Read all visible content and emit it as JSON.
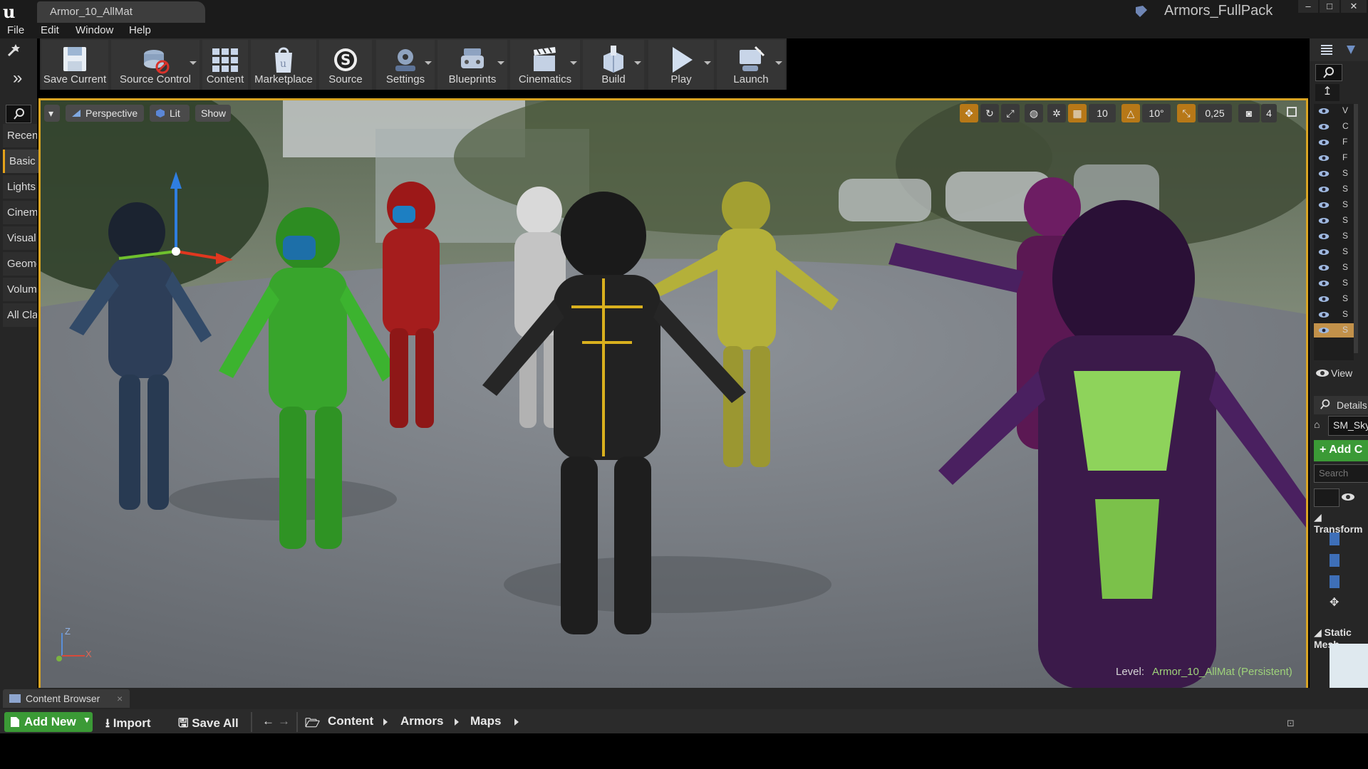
{
  "window": {
    "doc_tab": "Armor_10_AllMat",
    "project_name": "Armors_FullPack",
    "controls": [
      "–",
      "□",
      "✕"
    ]
  },
  "menu": [
    "File",
    "Edit",
    "Window",
    "Help"
  ],
  "modes_panel": {
    "tabs": [
      "Recently Placed",
      "Basic",
      "Lights",
      "Cinematic",
      "Visual Effects",
      "Geometry",
      "Volumes",
      "All Classes"
    ],
    "selected": "Basic"
  },
  "toolbar": [
    {
      "label": "Save Current",
      "icon": "save-icon",
      "dropdown": false
    },
    {
      "label": "Source Control",
      "icon": "source-control-icon",
      "dropdown": true
    },
    {
      "label": "Content",
      "icon": "content-icon",
      "dropdown": false
    },
    {
      "label": "Marketplace",
      "icon": "marketplace-icon",
      "dropdown": false
    },
    {
      "label": "Source",
      "icon": "source-icon",
      "dropdown": false
    },
    {
      "label": "Settings",
      "icon": "settings-icon",
      "dropdown": true
    },
    {
      "label": "Blueprints",
      "icon": "blueprints-icon",
      "dropdown": true
    },
    {
      "label": "Cinematics",
      "icon": "cinematics-icon",
      "dropdown": true
    },
    {
      "label": "Build",
      "icon": "build-icon",
      "dropdown": true
    },
    {
      "label": "Play",
      "icon": "play-icon",
      "dropdown": true
    },
    {
      "label": "Launch",
      "icon": "launch-icon",
      "dropdown": true
    }
  ],
  "viewport": {
    "view_mode": "Perspective",
    "lighting": "Lit",
    "show": "Show",
    "grid_snap": "10",
    "rotation_snap": "10°",
    "scale_snap": "0,25",
    "camera_speed": "4",
    "level_label": "Level:",
    "level_value": "Armor_10_AllMat (Persistent)",
    "axis_labels": {
      "z": "Z",
      "x": "X"
    },
    "accent_color": "#d9a423"
  },
  "outliner": {
    "rows": [
      "V",
      "C",
      "F",
      "F",
      "S",
      "S",
      "S",
      "S",
      "S",
      "S",
      "S",
      "S",
      "S",
      "S",
      "S"
    ],
    "selected_index": 14,
    "view_options": "View"
  },
  "details": {
    "tab": "Details",
    "actor": "SM_Sky",
    "add_component": "+ Add C",
    "search_placeholder": "Search",
    "sections": [
      "Transform",
      "Static Mesh"
    ]
  },
  "content_browser": {
    "tab": "Content Browser",
    "add_new": "Add New",
    "import": "Import",
    "save_all": "Save All",
    "path": [
      "Content",
      "Armors",
      "Maps"
    ],
    "add_color": "#3b9a36"
  }
}
